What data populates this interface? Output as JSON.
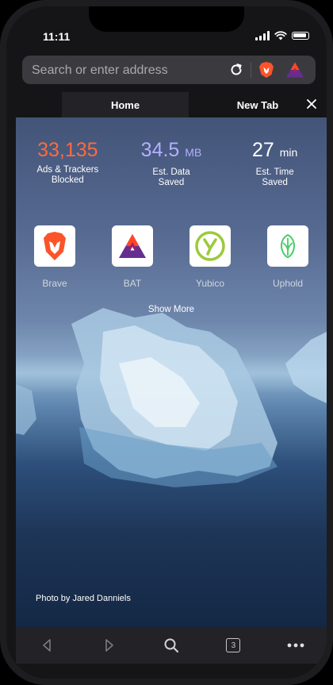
{
  "status_bar": {
    "time": "11:11"
  },
  "address_bar": {
    "placeholder": "Search or enter address"
  },
  "tabs": [
    {
      "label": "Home"
    },
    {
      "label": "New Tab"
    }
  ],
  "stats": [
    {
      "value": "33,135",
      "unit": "",
      "label_line1": "Ads & Trackers",
      "label_line2": "Blocked",
      "color": "#ff6a3d"
    },
    {
      "value": "34.5",
      "unit": "MB",
      "label_line1": "Est. Data",
      "label_line2": "Saved",
      "color": "#b3b0ff"
    },
    {
      "value": "27",
      "unit": "min",
      "label_line1": "Est. Time",
      "label_line2": "Saved",
      "color": "#ffffff"
    }
  ],
  "favorites": [
    {
      "label": "Brave",
      "icon": "brave-lion-icon"
    },
    {
      "label": "BAT",
      "icon": "bat-triangle-icon"
    },
    {
      "label": "Yubico",
      "icon": "yubico-icon"
    },
    {
      "label": "Uphold",
      "icon": "uphold-icon"
    }
  ],
  "show_more": "Show More",
  "photo_credit": "Photo by Jared Danniels",
  "toolbar": {
    "tab_count": "3"
  },
  "colors": {
    "brand_orange": "#fb542b",
    "bat_purple": "#662d91",
    "yubico_green": "#9aca3c",
    "uphold_green": "#49cc68"
  }
}
